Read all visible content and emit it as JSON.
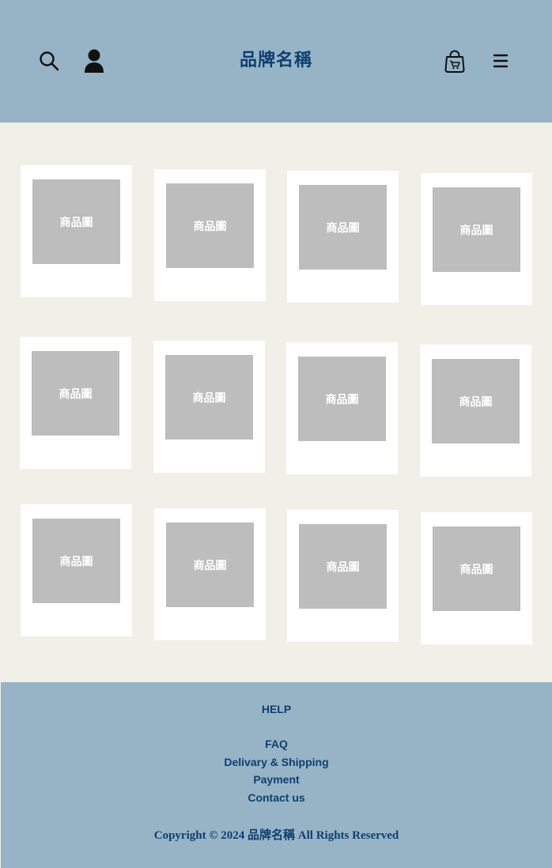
{
  "header": {
    "brand": "品牌名稱",
    "icons": [
      "search-icon",
      "user-icon",
      "shopping-bag-icon",
      "menu-icon"
    ]
  },
  "products": [
    {
      "image_label": "商品圖"
    },
    {
      "image_label": "商品圖"
    },
    {
      "image_label": "商品圖"
    },
    {
      "image_label": "商品圖"
    },
    {
      "image_label": "商品圖"
    },
    {
      "image_label": "商品圖"
    },
    {
      "image_label": "商品圖"
    },
    {
      "image_label": "商品圖"
    },
    {
      "image_label": "商品圖"
    },
    {
      "image_label": "商品圖"
    },
    {
      "image_label": "商品圖"
    },
    {
      "image_label": "商品圖"
    }
  ],
  "footer": {
    "help_title": "HELP",
    "links": [
      "FAQ",
      "Delivary & Shipping",
      "Payment",
      "Contact us"
    ],
    "copyright": "Copyright © 2024 品牌名稱 All Rights Reserved"
  },
  "colors": {
    "header_bg": "#96b4c6",
    "page_bg": "#f0efe8",
    "brand_text": "#0f3f6f",
    "placeholder": "#bdbdbd"
  }
}
